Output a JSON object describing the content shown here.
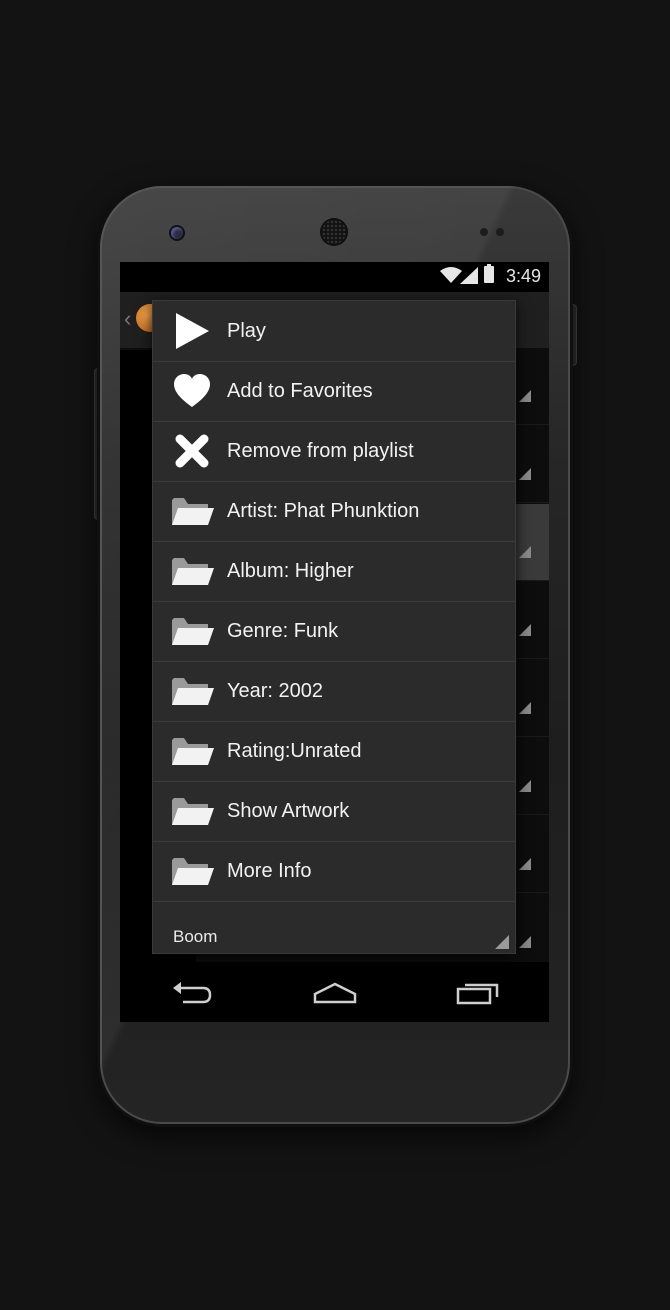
{
  "status_bar": {
    "time": "3:49",
    "icons": [
      "wifi-icon",
      "signal-icon",
      "battery-icon"
    ]
  },
  "context_menu": {
    "items": [
      {
        "label": "Play",
        "icon": "play-icon"
      },
      {
        "label": "Add to Favorites",
        "icon": "heart-icon"
      },
      {
        "label": "Remove from playlist",
        "icon": "close-icon"
      },
      {
        "label": "Artist: Phat Phunktion",
        "icon": "folder-icon"
      },
      {
        "label": "Album: Higher",
        "icon": "folder-icon"
      },
      {
        "label": "Genre: Funk",
        "icon": "folder-icon"
      },
      {
        "label": "Year: 2002",
        "icon": "folder-icon"
      },
      {
        "label": "Rating:Unrated",
        "icon": "folder-icon"
      },
      {
        "label": "Show Artwork",
        "icon": "folder-icon"
      },
      {
        "label": "More Info",
        "icon": "folder-icon"
      }
    ],
    "footer_label": "Boom"
  },
  "nav_bar": {
    "buttons": [
      "back-icon",
      "home-icon",
      "recents-icon"
    ]
  },
  "colors": {
    "menu_background": "#2b2b2b",
    "menu_text": "#f2f2f2",
    "screen_background": "#000000"
  }
}
